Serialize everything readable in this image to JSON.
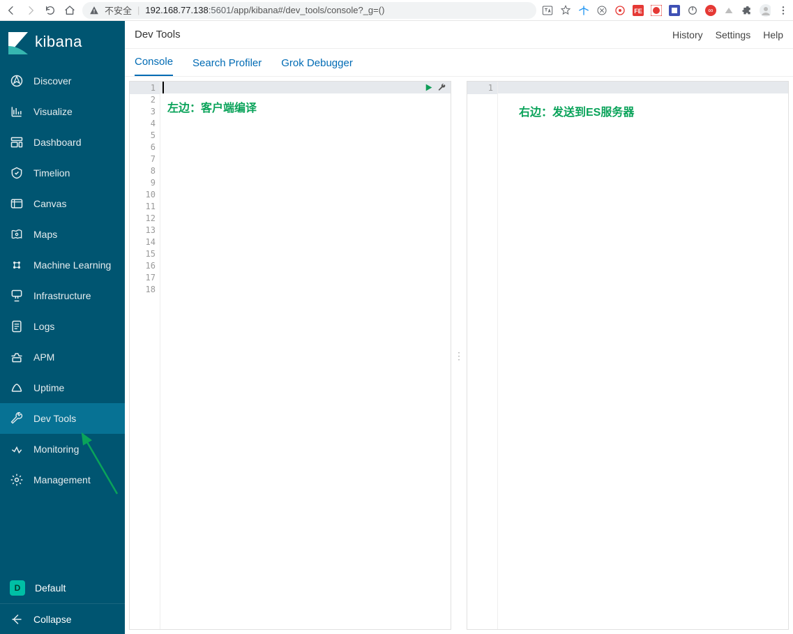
{
  "browser": {
    "security_label": "不安全",
    "url_host": "192.168.77.138",
    "url_port": ":5601",
    "url_path": "/app/kibana#/dev_tools/console?_g=()"
  },
  "logo": {
    "text": "kibana"
  },
  "sidebar": {
    "items": [
      {
        "label": "Discover"
      },
      {
        "label": "Visualize"
      },
      {
        "label": "Dashboard"
      },
      {
        "label": "Timelion"
      },
      {
        "label": "Canvas"
      },
      {
        "label": "Maps"
      },
      {
        "label": "Machine Learning"
      },
      {
        "label": "Infrastructure"
      },
      {
        "label": "Logs"
      },
      {
        "label": "APM"
      },
      {
        "label": "Uptime"
      },
      {
        "label": "Dev Tools"
      },
      {
        "label": "Monitoring"
      },
      {
        "label": "Management"
      }
    ],
    "active_index": 11,
    "space_letter": "D",
    "space_label": "Default",
    "collapse_label": "Collapse"
  },
  "header": {
    "title": "Dev Tools",
    "links": [
      "History",
      "Settings",
      "Help"
    ]
  },
  "tabs": {
    "items": [
      "Console",
      "Search Profiler",
      "Grok Debugger"
    ],
    "active_index": 0
  },
  "console": {
    "left_line_count": 18,
    "right_line_count": 1
  },
  "annotations": {
    "left": "左边：客户端编译",
    "right": "右边：发送到ES服务器"
  }
}
